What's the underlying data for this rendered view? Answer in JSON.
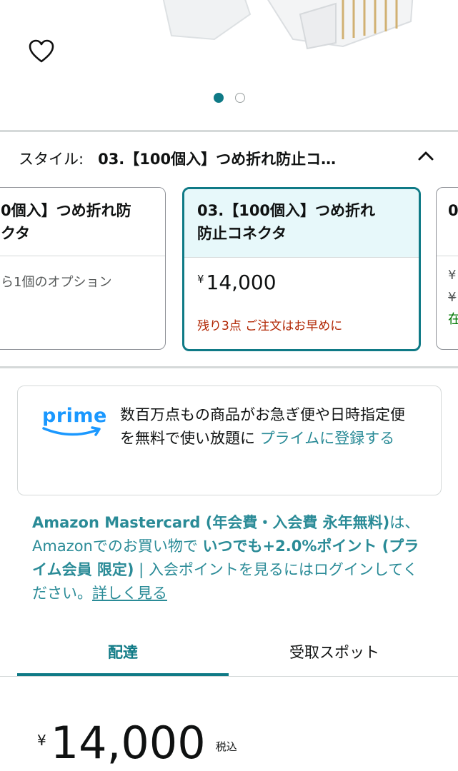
{
  "gallery": {
    "favorite_icon": "heart-outline-icon",
    "page_count": 2,
    "active_page": 1
  },
  "style_selector": {
    "label": "スタイル:",
    "selected_value": "03.【100個入】つめ折れ防止コ…",
    "collapse_icon": "chevron-up-icon",
    "options": [
      {
        "title": "0個入】つめ折れ防\nクタ",
        "sub": "ら1個のオプション"
      },
      {
        "title": "03.【100個入】つめ折れ\n防止コネクタ",
        "price_symbol": "¥",
        "price": "14,000",
        "stock": "残り3点 ご注文はお早めに"
      },
      {
        "title": "0",
        "line1": "¥",
        "line2": "¥",
        "line3": "在"
      }
    ]
  },
  "prime": {
    "logo_text": "prime",
    "text": "数百万点もの商品がお急ぎ便や日時指定便を無料で使い放題に ",
    "link": "プライムに登録する"
  },
  "mastercard": {
    "part1": "Amazon Mastercard (年会費・入会費 永年無料)",
    "part2": "は、Amazonでのお買い物で ",
    "part3": "いつでも+2.0%ポイント (プライム会員 限定)",
    "part4": " | 入会ポイントを見るにはログインしてください。",
    "more_link": "詳しく見る"
  },
  "tabs": [
    {
      "label": "配達"
    },
    {
      "label": "受取スポット"
    }
  ],
  "price": {
    "symbol": "¥",
    "amount": "14,000",
    "tax_label": "税込"
  },
  "colors": {
    "teal": "#0f7a86",
    "link": "#2a8b97",
    "stock_red": "#b12704",
    "prime_blue": "#1a98ff"
  }
}
